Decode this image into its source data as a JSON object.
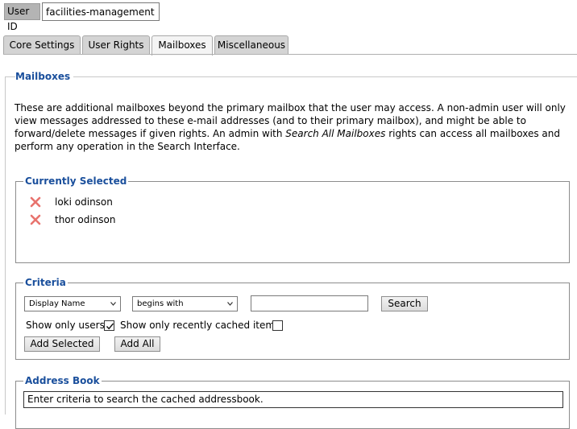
{
  "user": {
    "id_label": "User ID",
    "id_value": "facilities-management"
  },
  "tabs": [
    {
      "label": "Core Settings",
      "active": false
    },
    {
      "label": "User Rights",
      "active": false
    },
    {
      "label": "Mailboxes",
      "active": true
    },
    {
      "label": "Miscellaneous",
      "active": false
    }
  ],
  "panel": {
    "title": "Mailboxes",
    "desc_part1": "These are additional mailboxes beyond the primary mailbox that the user may access. A non-admin user will only view messages addressed to these e-mail addresses (and to their primary mailbox), and might be able to forward/delete messages if given rights. An admin with ",
    "desc_emphasis": "Search All Mailboxes",
    "desc_part2": " rights can access all mailboxes and perform any operation in the Search Interface."
  },
  "currently_selected": {
    "legend": "Currently Selected",
    "items": [
      {
        "name": "loki odinson"
      },
      {
        "name": "thor odinson"
      }
    ],
    "remove_icon": "x-icon"
  },
  "criteria": {
    "legend": "Criteria",
    "field_select": "Display Name",
    "match_select": "begins with",
    "search_value": "",
    "search_button": "Search",
    "show_only_users_label": "Show only users",
    "show_only_users_checked": true,
    "recently_cached_label": "Show only recently cached items",
    "recently_cached_checked": false,
    "add_selected_button": "Add Selected",
    "add_all_button": "Add All"
  },
  "address_book": {
    "legend": "Address Book",
    "placeholder": "Enter criteria to search the cached addressbook."
  },
  "colors": {
    "legend": "#1a4f9c",
    "remove_icon": "#e8736e"
  }
}
